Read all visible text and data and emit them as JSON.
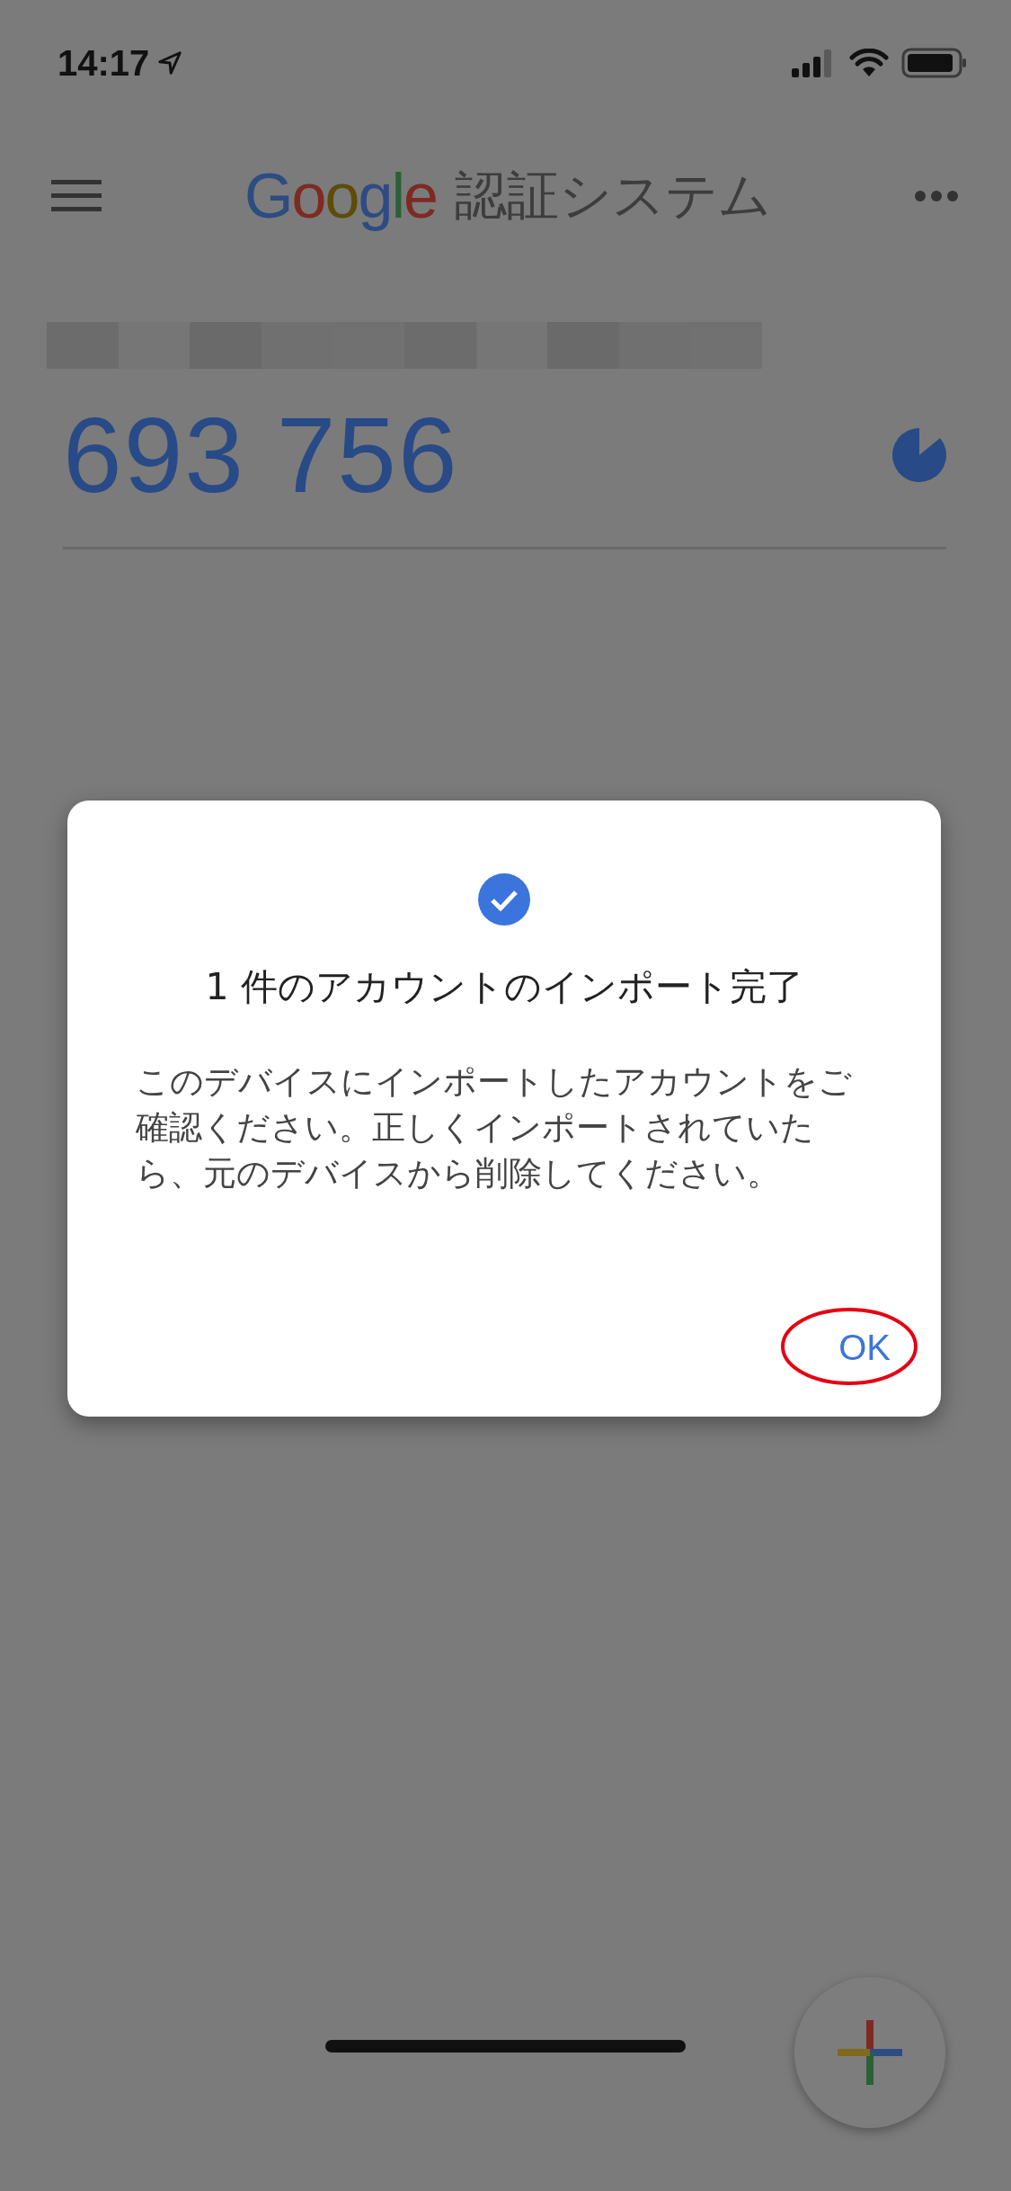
{
  "status_bar": {
    "time": "14:17"
  },
  "app_bar": {
    "logo": "Google",
    "title": "認証システム"
  },
  "accounts": [
    {
      "code": "693 756"
    }
  ],
  "dialog": {
    "title": "1 件のアカウントのインポート完了",
    "message": "このデバイスにインポートしたアカウントをご確認ください。正しくインポートされていたら、元のデバイスから削除してください。",
    "button": {
      "label": "OK",
      "annotated": true
    }
  }
}
